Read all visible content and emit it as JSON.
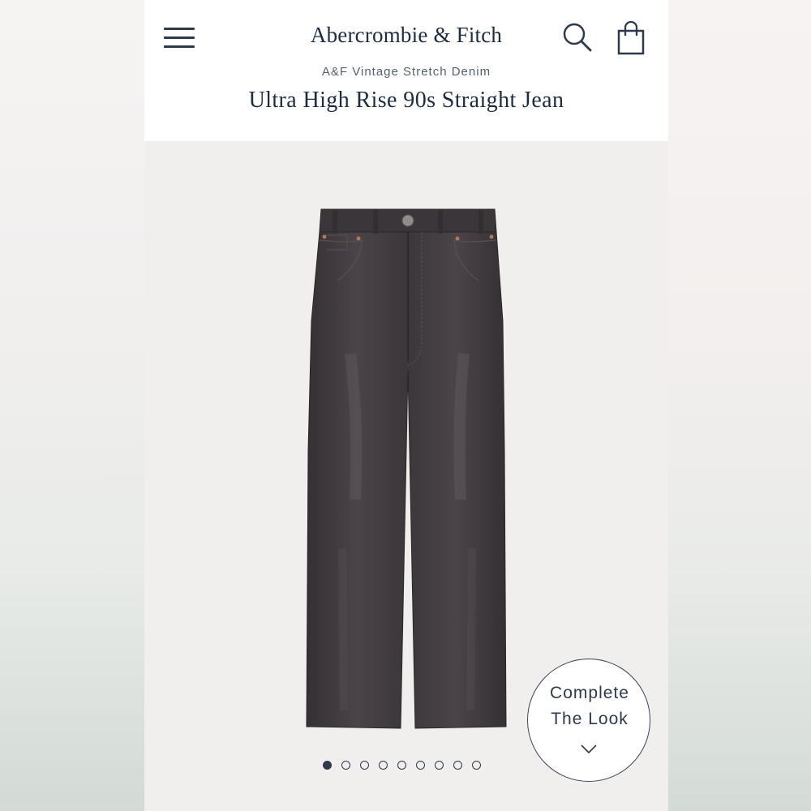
{
  "header": {
    "brand": "Abercrombie & Fitch",
    "menu_icon": "hamburger-menu-icon",
    "search_icon": "search-icon",
    "bag_icon": "shopping-bag-icon"
  },
  "product": {
    "collection": "A&F Vintage Stretch Denim",
    "title": "Ultra High Rise 90s Straight Jean",
    "color": "#3f3a3d"
  },
  "carousel": {
    "total": 9,
    "active_index": 0
  },
  "complete_look": {
    "line1": "Complete",
    "line2": "The Look",
    "icon": "chevron-down-icon"
  }
}
